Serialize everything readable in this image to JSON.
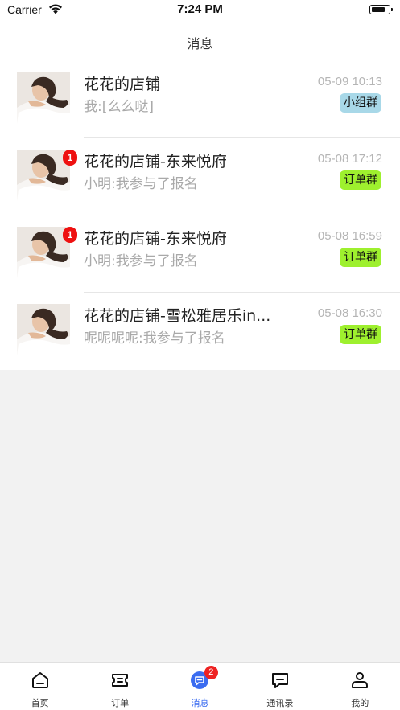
{
  "status_bar": {
    "carrier": "Carrier",
    "time": "7:24 PM",
    "icons": [
      "wifi-icon",
      "battery-icon"
    ]
  },
  "nav": {
    "title": "消息"
  },
  "conversations": [
    {
      "title": "花花的店铺",
      "time": "05-09 10:13",
      "preview": "我:[么么哒]",
      "tag": "小组群",
      "unread": ""
    },
    {
      "title": "花花的店铺-东来悦府",
      "time": "05-08 17:12",
      "preview": "小明:我参与了报名",
      "tag": "订单群",
      "unread": "1"
    },
    {
      "title": "花花的店铺-东来悦府",
      "time": "05-08 16:59",
      "preview": "小明:我参与了报名",
      "tag": "订单群",
      "unread": "1"
    },
    {
      "title": "花花的店铺-雪松雅居乐in...",
      "time": "05-08 16:30",
      "preview": "呢呢呢呢:我参与了报名",
      "tag": "订单群",
      "unread": ""
    }
  ],
  "colors": {
    "tag_small": "#a8d8e8",
    "tag_order": "#9ef02e",
    "badge": "#ee1111",
    "active": "#3b6cf0"
  },
  "tabs": [
    {
      "label": "首页",
      "icon": "home-icon"
    },
    {
      "label": "订单",
      "icon": "ticket-icon"
    },
    {
      "label": "消息",
      "icon": "message-icon",
      "badge": "2",
      "active": true
    },
    {
      "label": "通讯录",
      "icon": "contacts-icon"
    },
    {
      "label": "我的",
      "icon": "user-icon"
    }
  ]
}
